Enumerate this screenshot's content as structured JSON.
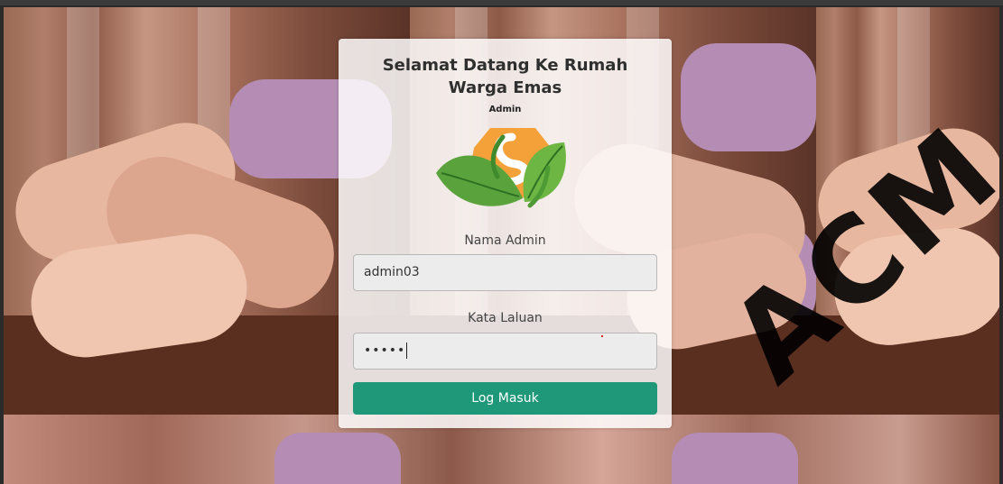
{
  "card": {
    "title": "Selamat Datang Ke Rumah Warga Emas",
    "role": "Admin",
    "logo": "leaf-sun-logo"
  },
  "form": {
    "username_label": "Nama Admin",
    "username_value": "admin03",
    "password_label": "Kata Laluan",
    "password_value": "•••••",
    "submit_label": "Log Masuk"
  },
  "colors": {
    "button": "#1f9779",
    "card": "#ffffff"
  },
  "watermark": "ACM",
  "background": "holding-hands-photo"
}
